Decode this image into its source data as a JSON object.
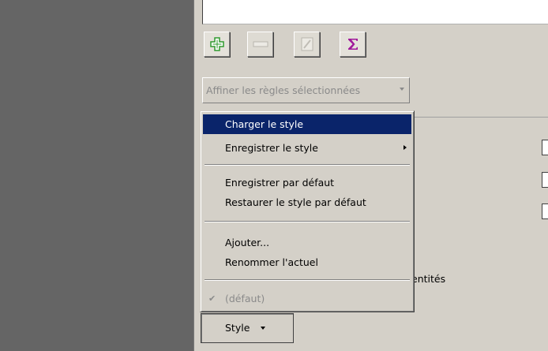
{
  "toolbar": {
    "add_icon": "plus-icon",
    "remove_icon": "minus-icon",
    "edit_icon": "document-icon",
    "sum_icon": "sigma-icon"
  },
  "refine": {
    "label": "Affiner les règles sélectionnées"
  },
  "menu": {
    "items": [
      {
        "label": "Charger le style"
      },
      {
        "label": "Enregistrer le style"
      },
      {
        "label": "Enregistrer par défaut"
      },
      {
        "label": "Restaurer le style par défaut"
      },
      {
        "label": "Ajouter..."
      },
      {
        "label": "Renommer l'actuel"
      },
      {
        "label": "(défaut)"
      }
    ]
  },
  "background_text": "entités",
  "style_button": {
    "label": "Style"
  },
  "colors": {
    "highlight": "#0a246a",
    "panel": "#656565",
    "face": "#d4d0c8",
    "plus": "#2e9a2e",
    "sigma": "#a0189a"
  }
}
